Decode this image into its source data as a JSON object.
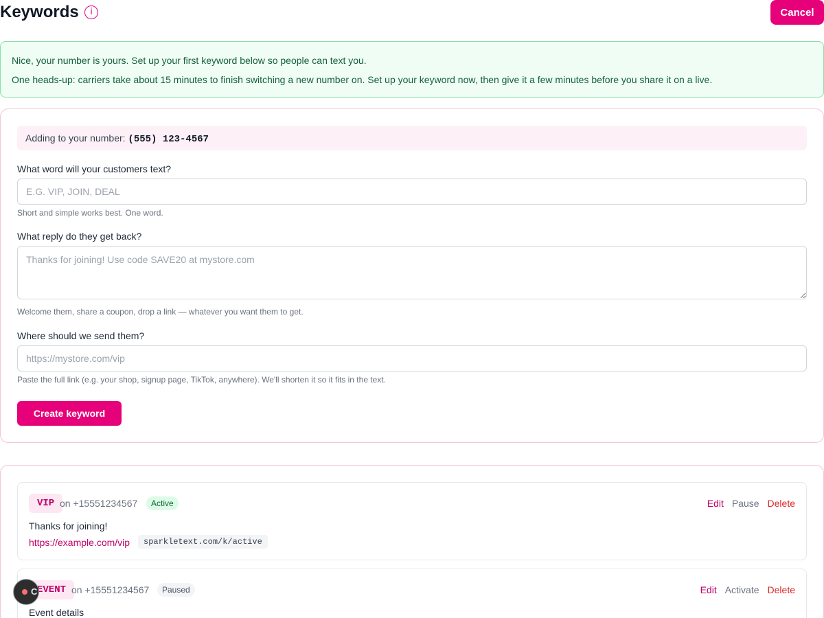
{
  "header": {
    "title": "Keywords",
    "info_icon": "i",
    "cancel_label": "Cancel"
  },
  "notice": {
    "line1": "Nice, your number is yours. Set up your first keyword below so people can text you.",
    "line2": "One heads-up: carriers take about 15 minutes to finish switching a new number on. Set up your keyword now, then give it a few minutes before you share it on a live."
  },
  "form": {
    "number_prefix": "Adding to your number: ",
    "number": "(555) 123-4567",
    "keyword_label": "What word will your customers text?",
    "keyword_placeholder": "E.G. VIP, JOIN, DEAL",
    "keyword_value": "",
    "keyword_hint": "Short and simple works best. One word.",
    "reply_label": "What reply do they get back?",
    "reply_placeholder": "Thanks for joining! Use code SAVE20 at mystore.com",
    "reply_value": "",
    "reply_hint": "Welcome them, share a coupon, drop a link — whatever you want them to get.",
    "link_label": "Where should we send them?",
    "link_placeholder": "https://mystore.com/vip",
    "link_value": "",
    "link_hint": "Paste the full link (e.g. your shop, signup page, TikTok, anywhere). We'll shorten it so it fits in the text.",
    "create_label": "Create keyword"
  },
  "keywords": [
    {
      "word": "VIP",
      "number": "on +15551234567",
      "status": "Active",
      "reply": "Thanks for joining!",
      "link": "https://example.com/vip",
      "short_link": "sparkletext.com/k/active",
      "actions": {
        "edit": "Edit",
        "toggle": "Pause",
        "delete": "Delete"
      }
    },
    {
      "word": "EVENT",
      "number": "on +15551234567",
      "status": "Paused",
      "reply": "Event details",
      "actions": {
        "edit": "Edit",
        "toggle": "Activate",
        "delete": "Delete"
      }
    }
  ],
  "fab": {
    "label": "C"
  },
  "colors": {
    "brand": "#e6007a",
    "success_bg": "#effdf4",
    "success_text": "#15603a",
    "delete": "#dc2626"
  }
}
